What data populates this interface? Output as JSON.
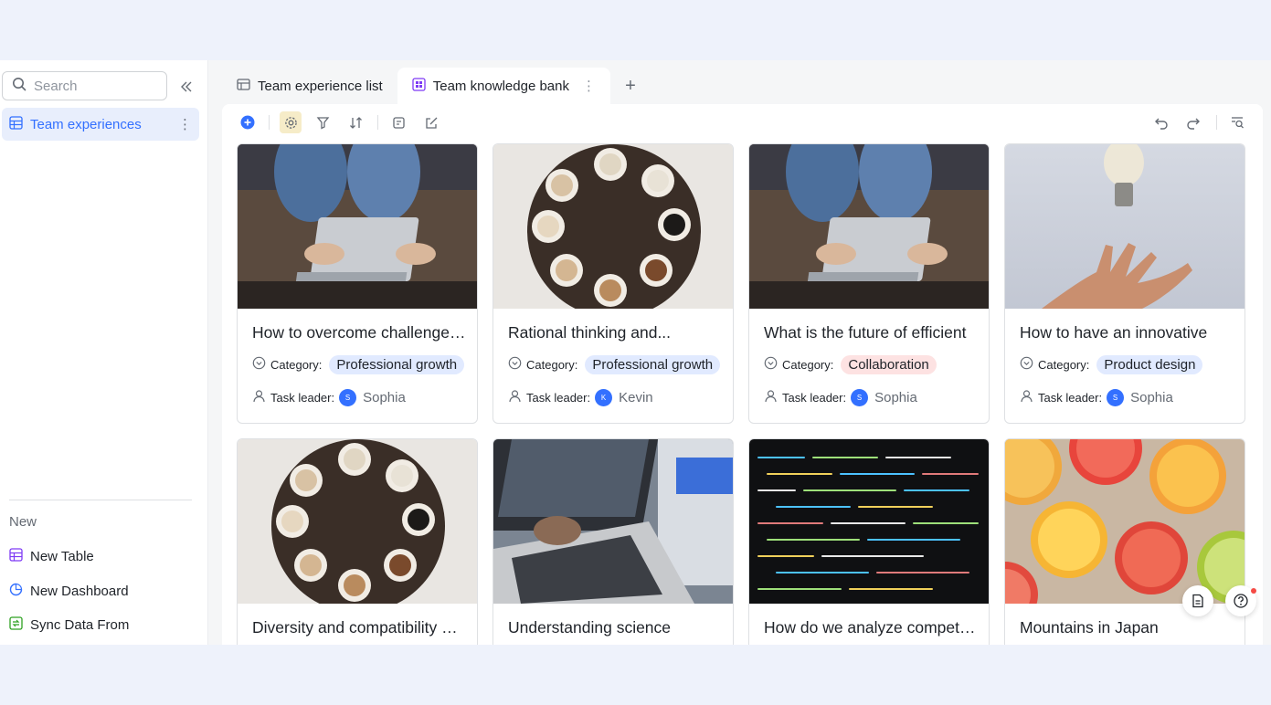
{
  "sidebar": {
    "search_placeholder": "Search",
    "items": [
      {
        "label": "Team experiences",
        "icon": "grid-table-icon"
      }
    ],
    "new_section_label": "New",
    "new_items": [
      {
        "label": "New Table",
        "icon": "table-icon"
      },
      {
        "label": "New Dashboard",
        "icon": "dashboard-icon"
      },
      {
        "label": "Sync Data From",
        "icon": "sync-icon"
      }
    ]
  },
  "tabs": [
    {
      "label": "Team experience list",
      "active": false
    },
    {
      "label": "Team knowledge bank",
      "active": true
    }
  ],
  "cards": [
    {
      "title": "How to overcome challenges?",
      "category_label": "Category:",
      "category": "Professional growth",
      "leader_label": "Task leader:",
      "leader": "Sophia",
      "leader_initial": "S",
      "cover": "laptop-hands"
    },
    {
      "title": "Rational thinking and...",
      "category_label": "Category:",
      "category": "Professional growth",
      "leader_label": "Task leader:",
      "leader": "Kevin",
      "leader_initial": "K",
      "cover": "coffee-table"
    },
    {
      "title": "What is the future of efficient",
      "category_label": "Category:",
      "category": "Collaboration",
      "leader_label": "Task leader:",
      "leader": "Sophia",
      "leader_initial": "S",
      "cover": "laptop-hands"
    },
    {
      "title": "How to have an innovative",
      "category_label": "Category:",
      "category": "Product design",
      "leader_label": "Task leader:",
      "leader": "Sophia",
      "leader_initial": "S",
      "cover": "lightbulb-hand"
    },
    {
      "title": "Diversity and compatibility at...",
      "cover": "coffee-table"
    },
    {
      "title": "Understanding science",
      "cover": "typing-laptop"
    },
    {
      "title": "How do we analyze competing",
      "cover": "code-screen"
    },
    {
      "title": "Mountains in Japan",
      "cover": "citrus-slices"
    }
  ],
  "colors": {
    "accent": "#3370ff",
    "tag_blue": "#e1eaff",
    "tag_red": "#fde2e2",
    "page_bg": "#eef2fb"
  }
}
